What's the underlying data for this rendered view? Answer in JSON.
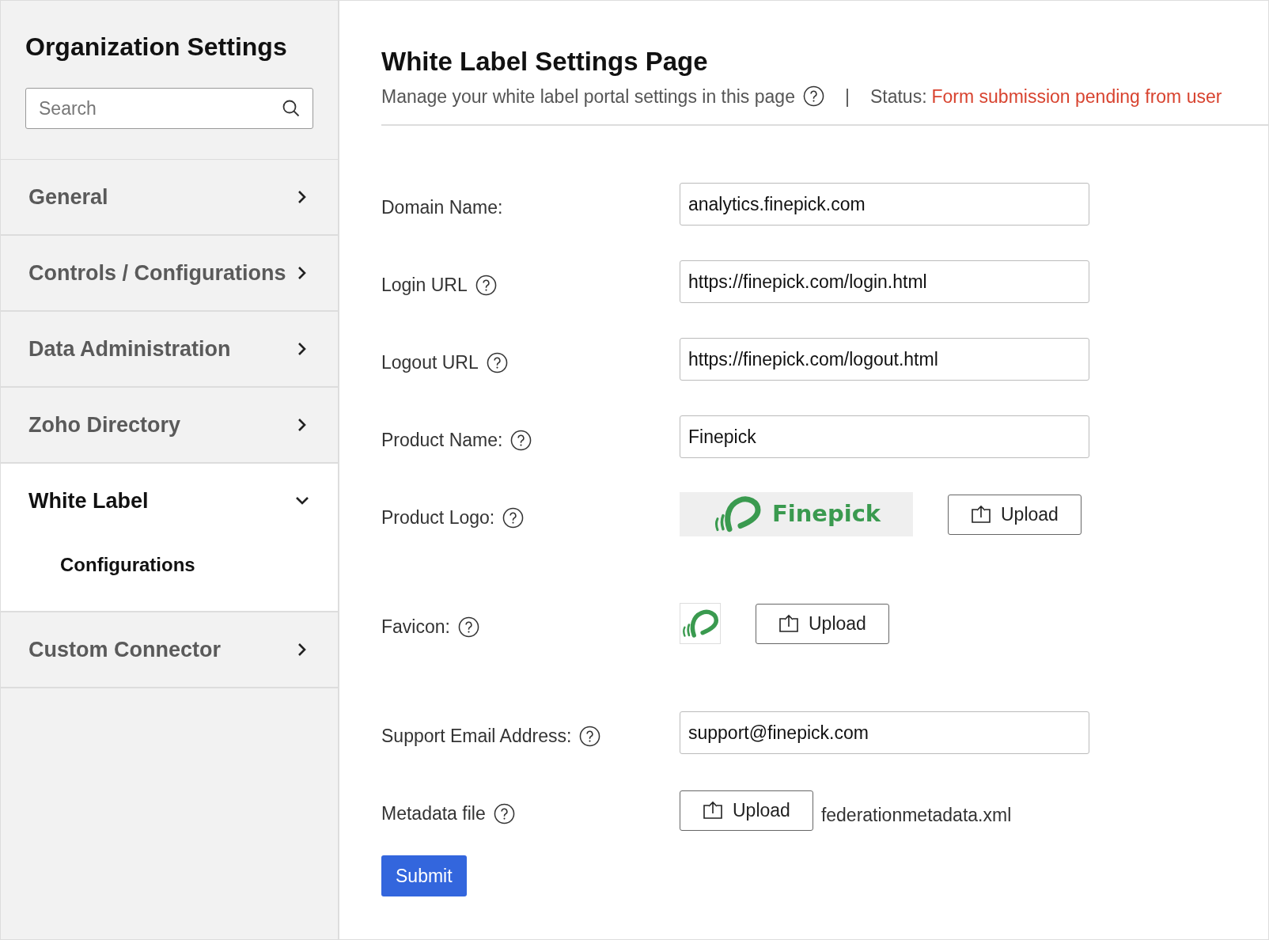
{
  "sidebar": {
    "title": "Organization Settings",
    "search": {
      "placeholder": "Search"
    },
    "items": [
      {
        "label": "General",
        "expanded": false
      },
      {
        "label": "Controls / Configurations",
        "expanded": false
      },
      {
        "label": "Data Administration",
        "expanded": false
      },
      {
        "label": "Zoho Directory",
        "expanded": false
      },
      {
        "label": "White Label",
        "expanded": true,
        "children": [
          {
            "label": "Configurations"
          }
        ]
      },
      {
        "label": "Custom Connector",
        "expanded": false
      }
    ]
  },
  "page": {
    "title": "White Label Settings Page",
    "subtitle": "Manage your white label portal settings in this page",
    "separator": "|",
    "status_label": "Status:",
    "status_value": "Form submission pending from user"
  },
  "fields": [
    {
      "kind": "text",
      "label": "Domain Name:",
      "help": false,
      "value": "analytics.finepick.com"
    },
    {
      "kind": "text",
      "label": "Login URL",
      "help": true,
      "value": "https://finepick.com/login.html"
    },
    {
      "kind": "text",
      "label": "Logout URL",
      "help": true,
      "value": "https://finepick.com/logout.html"
    },
    {
      "kind": "text",
      "label": "Product Name:",
      "help": true,
      "value": "Finepick"
    },
    {
      "kind": "logo",
      "label": "Product Logo:",
      "help": true,
      "logo_text": "Finepick",
      "button": "Upload"
    },
    {
      "kind": "favicon",
      "label": "Favicon:",
      "help": true,
      "button": "Upload"
    },
    {
      "kind": "text",
      "label": "Support Email Address:",
      "help": true,
      "value": "support@finepick.com"
    },
    {
      "kind": "file",
      "label": "Metadata file",
      "help": true,
      "button": "Upload",
      "file_name": "federationmetadata.xml"
    }
  ],
  "submit": "Submit"
}
